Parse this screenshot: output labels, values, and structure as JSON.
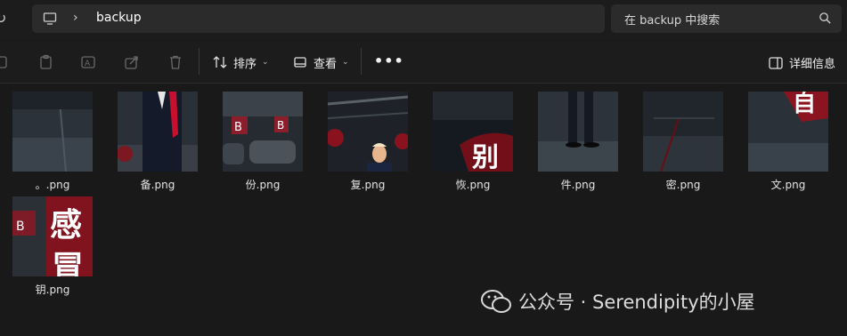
{
  "address_bar": {
    "path": "backup"
  },
  "search": {
    "placeholder": "在 backup 中搜索"
  },
  "toolbar": {
    "sort_label": "排序",
    "view_label": "查看",
    "more_label": "•••",
    "details_label": "详细信息"
  },
  "files": [
    {
      "name": "。.png"
    },
    {
      "name": "备.png"
    },
    {
      "name": "份.png"
    },
    {
      "name": "复.png"
    },
    {
      "name": "恢.png"
    },
    {
      "name": "件.png"
    },
    {
      "name": "密.png"
    },
    {
      "name": "文.png"
    },
    {
      "name": "钥.png"
    }
  ],
  "thumb_text": {
    "file5": "别",
    "file8": "自",
    "file9_a": "感",
    "file9_b": "冒",
    "file3_a": "B",
    "file3_b": "B",
    "file9_c": "B"
  },
  "watermark": {
    "text": "公众号 · Serendipity的小屋"
  },
  "colors": {
    "background": "#191919",
    "accent_red": "#c8102e"
  }
}
